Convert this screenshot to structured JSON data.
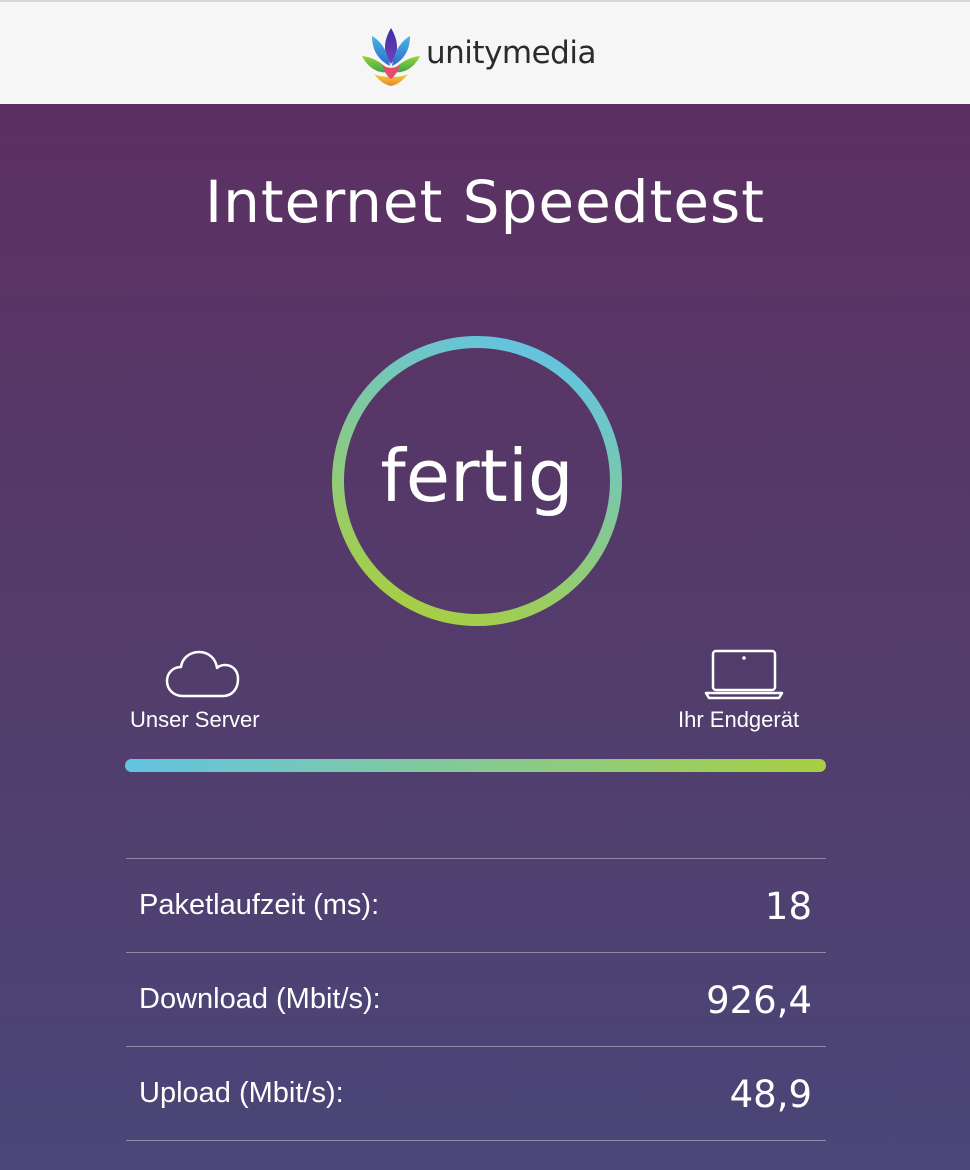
{
  "header": {
    "brand": "unitymedia",
    "logo_icon": "unitymedia-flower-logo"
  },
  "page": {
    "title": "Internet Speedtest"
  },
  "gauge": {
    "status": "fertig",
    "ring_colors": [
      "#62c4e3",
      "#a8cf42"
    ]
  },
  "connection": {
    "server_label": "Unser Server",
    "server_icon": "cloud-icon",
    "device_label": "Ihr Endgerät",
    "device_icon": "laptop-icon",
    "progress": 1.0,
    "progress_colors": [
      "#62c4e3",
      "#a8cf42"
    ]
  },
  "results": [
    {
      "label": "Paketlaufzeit (ms):",
      "value": "18"
    },
    {
      "label": "Download (Mbit/s):",
      "value": "926,4"
    },
    {
      "label": "Upload (Mbit/s):",
      "value": "48,9"
    }
  ],
  "colors": {
    "background_top": "#5c3062",
    "background_bottom": "#4a4678",
    "header_background": "#f6f6f6",
    "text": "#ffffff"
  }
}
